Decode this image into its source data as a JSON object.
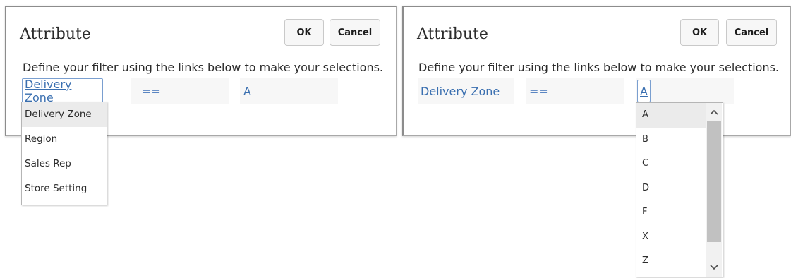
{
  "left_dialog": {
    "title": "Attribute",
    "ok_label": "OK",
    "cancel_label": "Cancel",
    "instruction": "Define your filter using the links below to make your selections.",
    "condition": {
      "attribute": "Delivery Zone",
      "operator": "==",
      "value": "A"
    },
    "attribute_menu": {
      "items": [
        "Delivery Zone",
        "Region",
        "Sales Rep",
        "Store Setting"
      ],
      "highlighted": "Delivery Zone"
    }
  },
  "right_dialog": {
    "title": "Attribute",
    "ok_label": "OK",
    "cancel_label": "Cancel",
    "instruction": "Define your filter using the links below to make your selections.",
    "condition": {
      "attribute": "Delivery Zone",
      "operator": "==",
      "value": "A"
    },
    "value_menu": {
      "items": [
        "A",
        "B",
        "C",
        "D",
        "F",
        "X",
        "Z"
      ],
      "highlighted": "A",
      "scroll_up_icon": "chevron-up-icon",
      "scroll_down_icon": "chevron-down-icon"
    }
  },
  "colors": {
    "link": "#3a6fb0",
    "cell_bg": "#f7f7f7",
    "highlight_bg": "#ebebeb"
  }
}
